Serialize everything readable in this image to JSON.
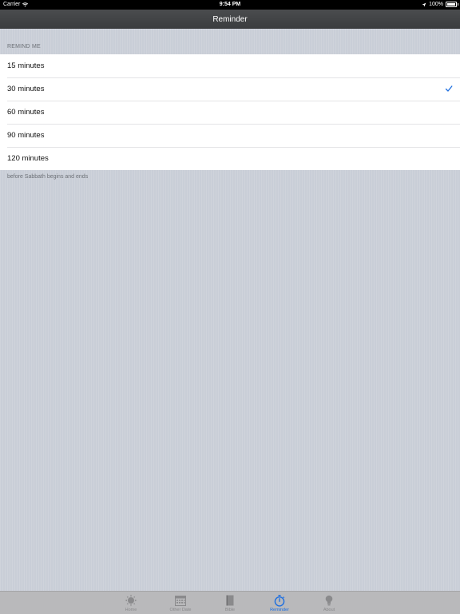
{
  "status_bar": {
    "carrier": "Carrier",
    "time": "9:54 PM",
    "battery": "100%"
  },
  "nav": {
    "title": "Reminder"
  },
  "section": {
    "header": "REMIND ME",
    "footer": "before Sabbath begins and ends",
    "options": [
      {
        "label": "15 minutes",
        "selected": false
      },
      {
        "label": "30 minutes",
        "selected": true
      },
      {
        "label": "60 minutes",
        "selected": false
      },
      {
        "label": "90 minutes",
        "selected": false
      },
      {
        "label": "120 minutes",
        "selected": false
      }
    ]
  },
  "tabs": [
    {
      "label": "Home",
      "icon": "sun-icon",
      "active": false
    },
    {
      "label": "Other Date",
      "icon": "calendar-icon",
      "active": false
    },
    {
      "label": "Bible",
      "icon": "book-icon",
      "active": false
    },
    {
      "label": "Reminder",
      "icon": "stopwatch-icon",
      "active": true
    },
    {
      "label": "About",
      "icon": "lightbulb-icon",
      "active": false
    }
  ],
  "colors": {
    "accent": "#1e6fe0",
    "tab_inactive": "#8a8a8c"
  }
}
